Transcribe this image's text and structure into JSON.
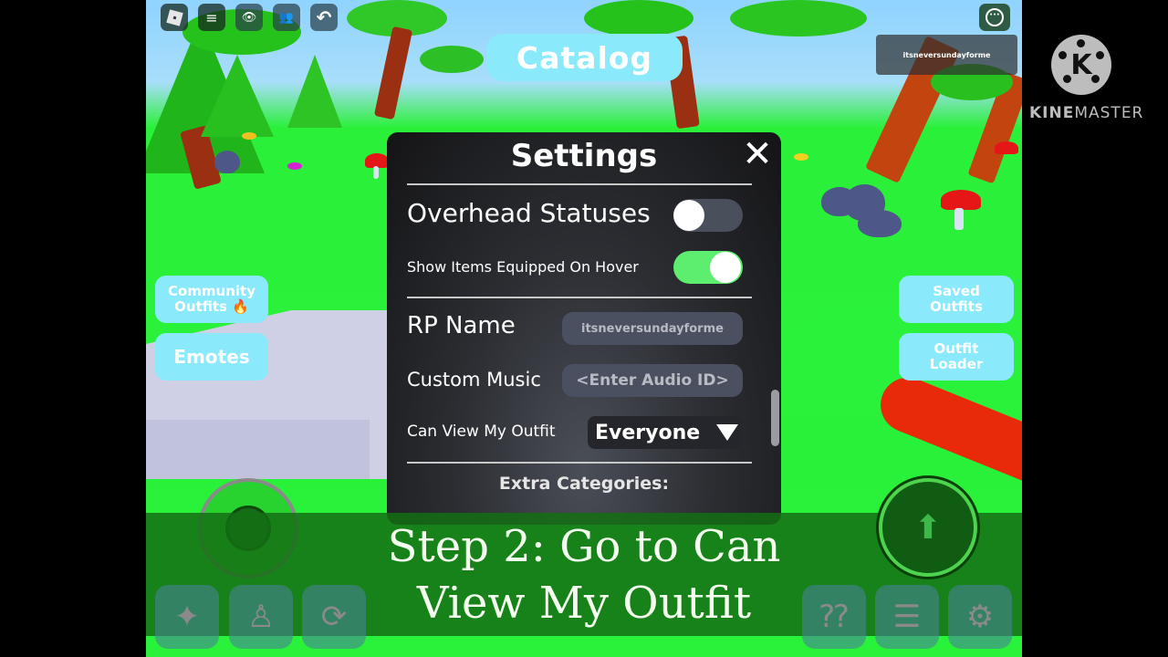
{
  "game": {
    "topbar": [
      {
        "icon": "roblox-menu-icon",
        "glyph": ""
      },
      {
        "icon": "chat-icon",
        "glyph": "≡"
      },
      {
        "icon": "eye-icon",
        "glyph": "👁"
      },
      {
        "icon": "friends-icon",
        "glyph": "👥"
      },
      {
        "icon": "undo-icon",
        "glyph": "↶"
      }
    ],
    "more_glyph": "···",
    "username_tag": "itsneversundayforme",
    "catalog_label": "Catalog",
    "left_buttons": [
      {
        "label": "Community Outfits 🔥"
      },
      {
        "label": "Emotes"
      }
    ],
    "right_buttons": [
      {
        "label": "Saved Outfits"
      },
      {
        "label": "Outfit Loader"
      }
    ],
    "bottom_left_buttons": [
      {
        "icon": "sparkles-icon",
        "glyph": "✦"
      },
      {
        "icon": "avatar-icon",
        "glyph": "♙"
      },
      {
        "icon": "refresh-icon",
        "glyph": "⟳"
      }
    ],
    "bottom_right_buttons": [
      {
        "icon": "mystery-box-icon",
        "glyph": "⁇"
      },
      {
        "icon": "list-icon",
        "glyph": "☰"
      },
      {
        "icon": "gear-icon",
        "glyph": "⚙"
      }
    ],
    "jump_glyph": "⬆"
  },
  "settings": {
    "title": "Settings",
    "close_glyph": "✕",
    "overhead_statuses": {
      "label": "Overhead Statuses",
      "enabled": false
    },
    "show_items_on_hover": {
      "label": "Show Items Equipped On Hover",
      "enabled": true
    },
    "rp_name": {
      "label": "RP Name",
      "value": "itsneversundayforme"
    },
    "custom_music": {
      "label": "Custom Music",
      "placeholder": "<Enter Audio ID>"
    },
    "can_view_outfit": {
      "label": "Can View My Outfit",
      "selected": "Everyone"
    },
    "extra_categories_label": "Extra Categories:",
    "colors": {
      "toggle_on": "#5ded6f",
      "toggle_off": "#4a4f5c"
    }
  },
  "caption": {
    "line1": "Step 2: Go to Can",
    "line2": "View My Outfit"
  },
  "watermark": {
    "logo_letter": "K",
    "brand_bold": "KINE",
    "brand_light": "MASTER"
  }
}
